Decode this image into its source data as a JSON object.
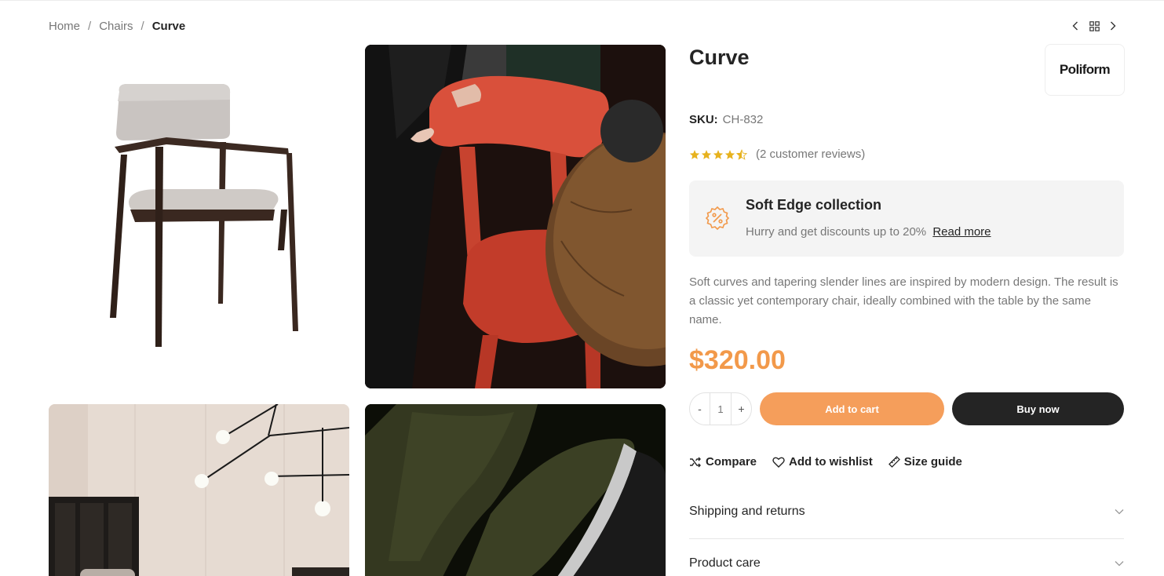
{
  "breadcrumb": {
    "items": [
      "Home",
      "Chairs"
    ],
    "separator": "/",
    "current": "Curve"
  },
  "product_nav": {
    "prev_icon": "chevron-left-icon",
    "grid_icon": "grid-icon",
    "next_icon": "chevron-right-icon"
  },
  "product": {
    "title": "Curve",
    "brand": "Poliform",
    "sku_label": "SKU:",
    "sku_value": "CH-832",
    "rating": 4.5,
    "rating_max": 5,
    "reviews_text": "(2 customer reviews)",
    "description": "Soft curves and tapering slender lines are inspired by modern design. The result is a classic yet contemporary chair, ideally combined with the table by the same name.",
    "price": "$320.00"
  },
  "promo": {
    "icon": "discount-badge-icon",
    "title": "Soft Edge collection",
    "text": "Hurry and get discounts up to 20%",
    "link": "Read more"
  },
  "quantity": {
    "minus": "-",
    "value": "1",
    "plus": "+"
  },
  "buttons": {
    "add_to_cart": "Add to cart",
    "buy_now": "Buy now"
  },
  "actions": {
    "compare": "Compare",
    "wishlist": "Add to wishlist",
    "size_guide": "Size guide"
  },
  "accordion": {
    "shipping": "Shipping and returns",
    "care": "Product care"
  },
  "colors": {
    "accent": "#f2994a",
    "cart_button": "#f59e5b",
    "dark": "#242424",
    "muted": "#777777",
    "star": "#e7b21e"
  }
}
